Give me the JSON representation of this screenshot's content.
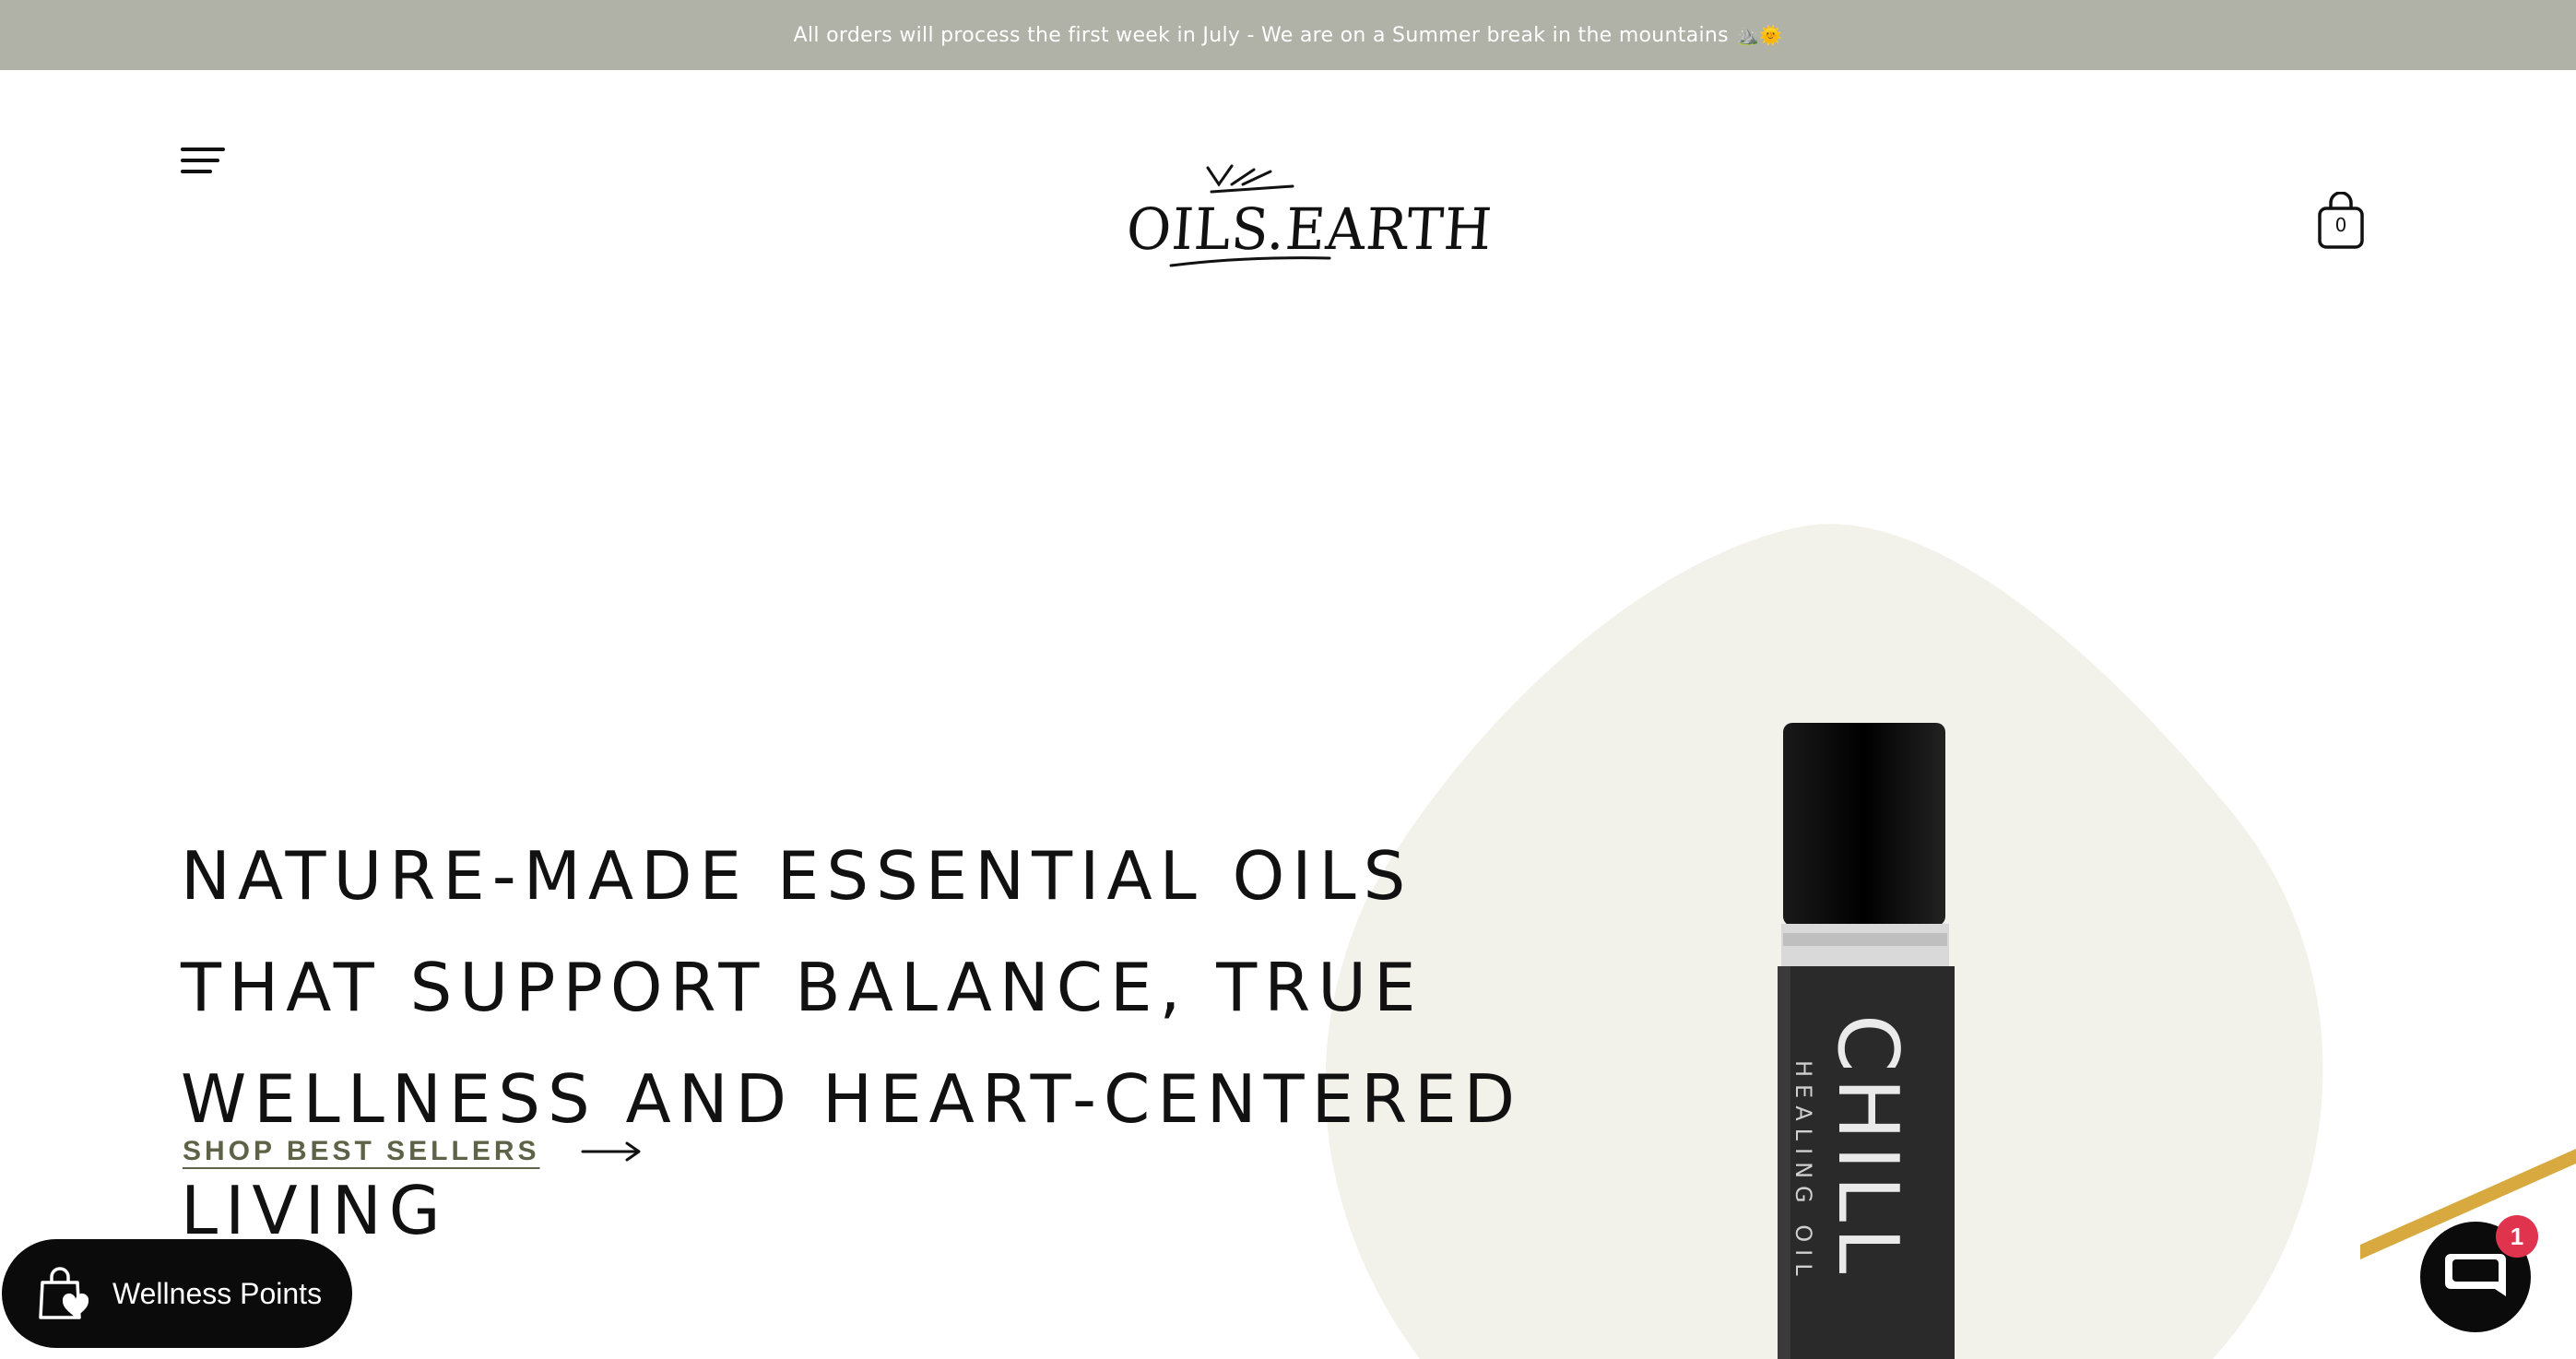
{
  "announcement": {
    "text": "All orders will process the first week in July - We are on a Summer break in the mountains",
    "emoji": "⛰️🌞"
  },
  "header": {
    "menu_icon": "hamburger-menu-icon",
    "logo_text": "OILS.EARTH",
    "cart_icon": "shopping-bag-icon",
    "cart_count": "0"
  },
  "hero": {
    "headline": "Nature-made essential oils that support balance, true wellness and heart-centered living",
    "cta_label": "SHOP BEST SELLERS",
    "cta_icon": "arrow-right-icon",
    "product": {
      "label_main": "CHILL",
      "label_sub": "HEALING OIL"
    }
  },
  "widgets": {
    "wellness_label": "Wellness Points",
    "wellness_icon": "shopping-bag-heart-icon",
    "chat_icon": "chat-bubble-icon",
    "chat_badge": "1"
  },
  "colors": {
    "announcement_bg": "#b0b2a8",
    "cta_text": "#5c6347",
    "blob": "#f3f2ea",
    "badge": "#e0344e"
  }
}
